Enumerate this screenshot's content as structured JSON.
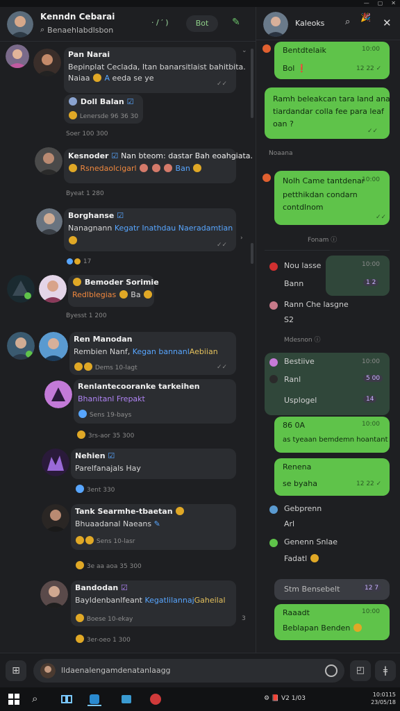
{
  "window": {
    "controls": [
      "—",
      "▢",
      "✕"
    ]
  },
  "left_header": {
    "title": "Kenndn Cebarai",
    "subtitle": "Benaehlabdlsbon",
    "tools": "· / ′ )",
    "bot_label": "Bot"
  },
  "messages": [
    {
      "name": "Pan Narai",
      "lines": [
        "Bepinplat Ceclada, Itan banarsitlaist bahitbita.",
        "Naiaa"
      ],
      "extra": "eeda se ye"
    },
    {
      "name": "Doll Balan",
      "meta": "Lenersde 96 36 30"
    },
    {
      "sep": "Soer 100 300"
    },
    {
      "name": "Kesnoder",
      "name_extra": "Nan bteom: dastar Bah eoahgiata.",
      "line_orange": "Rsnedaolcigarl",
      "line_blue": "Ban"
    },
    {
      "sep": "Byeat 1 280"
    },
    {
      "name": "Borghanse",
      "line_a": "Nanagnann",
      "line_b": "Kegatr Inathdau Naeradamtian",
      "check": "✓✓"
    },
    {
      "sep": "17"
    },
    {
      "name": "Bemoder Sorimie",
      "line_orange": "Redlblegias",
      "line": "Ba"
    },
    {
      "sep": "Byesst 1 200"
    },
    {
      "name": "Ren Manodan",
      "line_a": "Rembien Nanf,",
      "line_b": "Kegan bannanl",
      "line_c": "Aebiian",
      "meta": "Dems 10-lagt"
    },
    {
      "name": "Renlantecooranke tarkeihen",
      "line_purple": "Bhanitanl Frepakt",
      "meta": "Sens 19-bays"
    },
    {
      "sep": "3rs-aor 35 300"
    },
    {
      "name": "Nehien",
      "line": "Parelfanajals Hay"
    },
    {
      "sep": "3ent 330"
    },
    {
      "name": "Tank Searmhe-tbaetan",
      "line": "Bhuaadanal Naeans",
      "meta": "Sens 10-lasr"
    },
    {
      "sep": "3e aa aoa 35 300"
    },
    {
      "name": "Bandodan",
      "line_a": "Bayldenbanlfeant",
      "line_b": "Kegatlilannaj",
      "line_c": "Gaheilal",
      "meta": "Boese 10-ekay"
    },
    {
      "sep": "3er-oeo 1 300"
    }
  ],
  "right_header": {
    "title": "Kaleoks"
  },
  "right": {
    "g1": {
      "title": "Bentdtelaik",
      "sub": "Bol",
      "time_top": "10:00",
      "time": "12 22"
    },
    "g2": {
      "lines": [
        "Ramh beleakcan tara land ana",
        "tiardandar colla fee para leaf",
        "oan ?"
      ]
    },
    "label1": "Noaana",
    "g3": {
      "title": "Nolh Came tantdenar",
      "sub": "petthikdan condarn",
      "sub2": "contdlnom",
      "time": "10:00"
    },
    "label2": "Fonam",
    "item1": {
      "title": "Nou lasse",
      "sub": "Bann",
      "time": "10:00",
      "pill": "1 2"
    },
    "item2": {
      "title": "Rann Che lasgne",
      "sub": "S2"
    },
    "label3": "Mdesnon",
    "item3": {
      "title": "Bestiive",
      "sub": "Ranl",
      "sub2": "Usplogel",
      "time": "10:00",
      "pill1": "5 00",
      "pill2": "14"
    },
    "g4": {
      "title": "86 0A",
      "sub": "as tyeaan bemdemn hoantant",
      "time": "10:00"
    },
    "g5": {
      "title": "Renena",
      "sub": "se byaha",
      "time": "12 22"
    },
    "item4": {
      "title": "Gebprenn",
      "sub": "Arl"
    },
    "item5": {
      "title": "Genenn Snlae",
      "sub": "Fadatl"
    },
    "search_pill": {
      "label": "Stm Bensebelt",
      "tag": "12 7"
    },
    "g6": {
      "title": "Raaadt",
      "sub": "Beblapan Benden",
      "time": "10:00"
    }
  },
  "composer": {
    "placeholder": "lldaenalengamdenatanlaagg"
  },
  "taskbar": {
    "tray": "V2 1/03",
    "clock1": "10:0115",
    "clock2": "23/05/18"
  },
  "colors": {
    "accent_green": "#5fc34a",
    "bubble_dark": "#2b2d31",
    "bg": "#1e1f22"
  }
}
